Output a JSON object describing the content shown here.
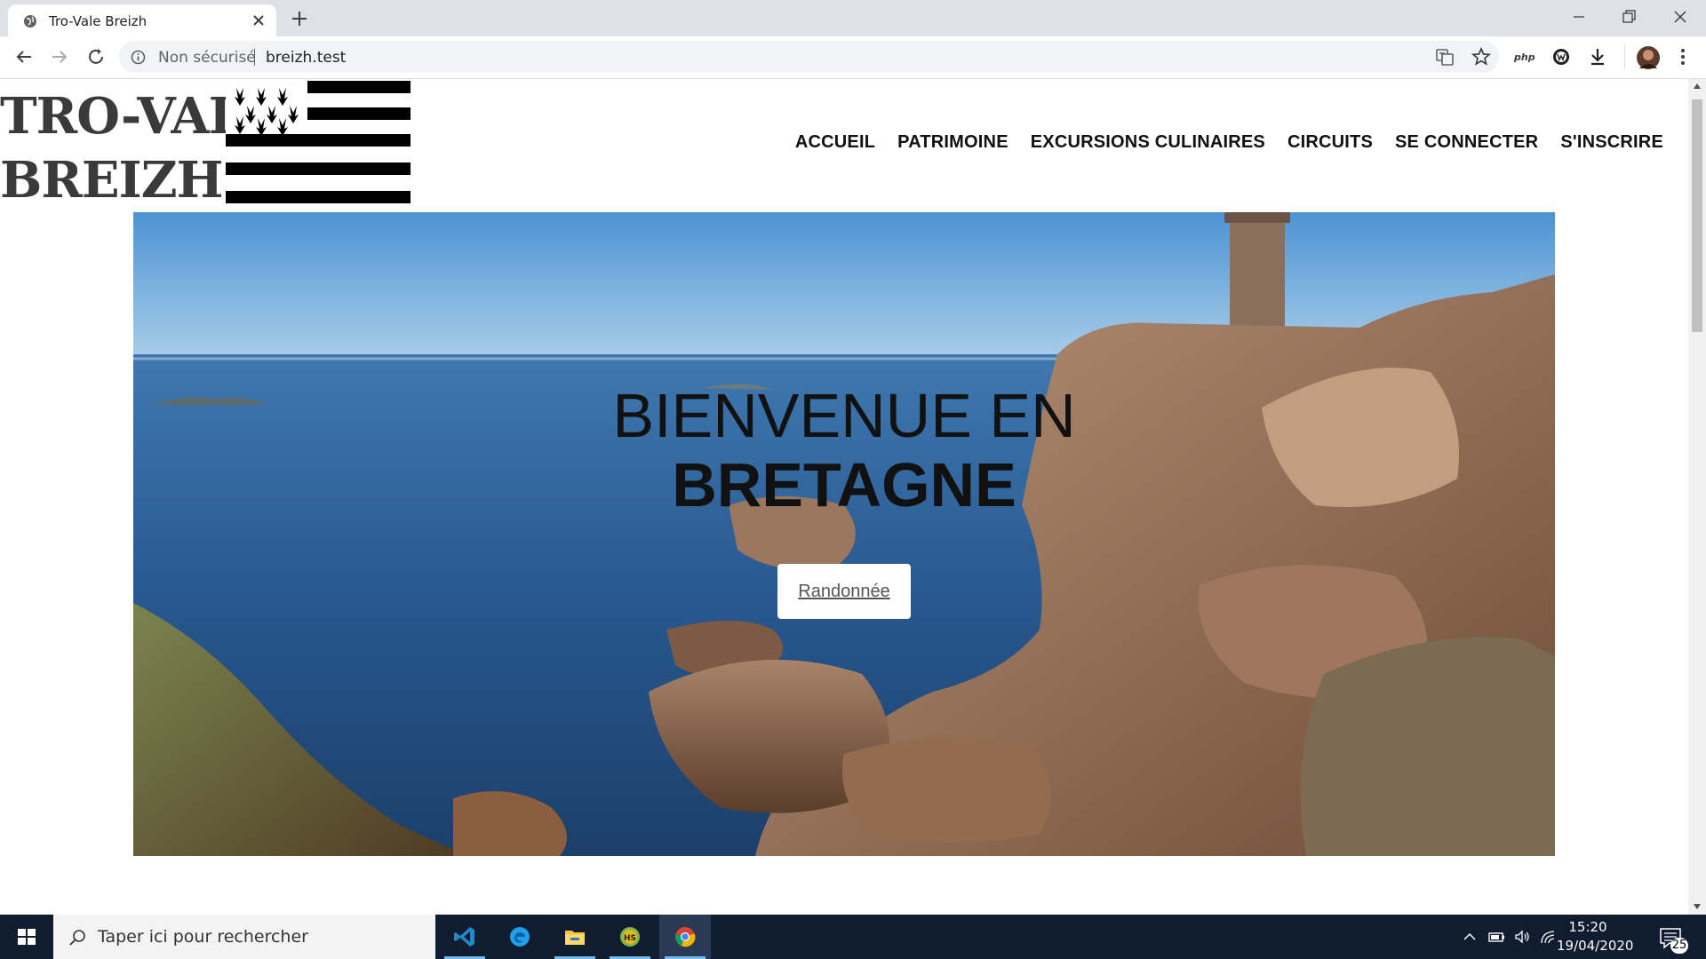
{
  "browser": {
    "tab_title": "Tro-Vale Breizh",
    "security_label": "Non sécurisé",
    "url": "breizh.test"
  },
  "site": {
    "logo_line1": "TRO-VALE",
    "logo_line2": "BREIZH .",
    "nav": {
      "home": "ACCUEIL",
      "heritage": "PATRIMOINE",
      "culinary": "EXCURSIONS CULINAIRES",
      "circuits": "CIRCUITS",
      "login": "SE CONNECTER",
      "signup": "S'INSCRIRE"
    },
    "hero": {
      "title_line1": "BIENVENUE EN",
      "title_line2": "BRETAGNE",
      "button_label": "Randonnée"
    }
  },
  "taskbar": {
    "search_placeholder": "Taper ici pour rechercher",
    "time": "15:20",
    "date": "19/04/2020",
    "notification_count": "25",
    "apps": [
      "vscode-icon",
      "edge-icon",
      "file-explorer-icon",
      "heidisql-icon",
      "chrome-icon"
    ],
    "active_app": "chrome-icon"
  },
  "colors": {
    "tabstrip": "#dee1e6",
    "taskbar": "#101c30",
    "nav_text": "#111111",
    "logo_text": "#3a3a3a"
  }
}
